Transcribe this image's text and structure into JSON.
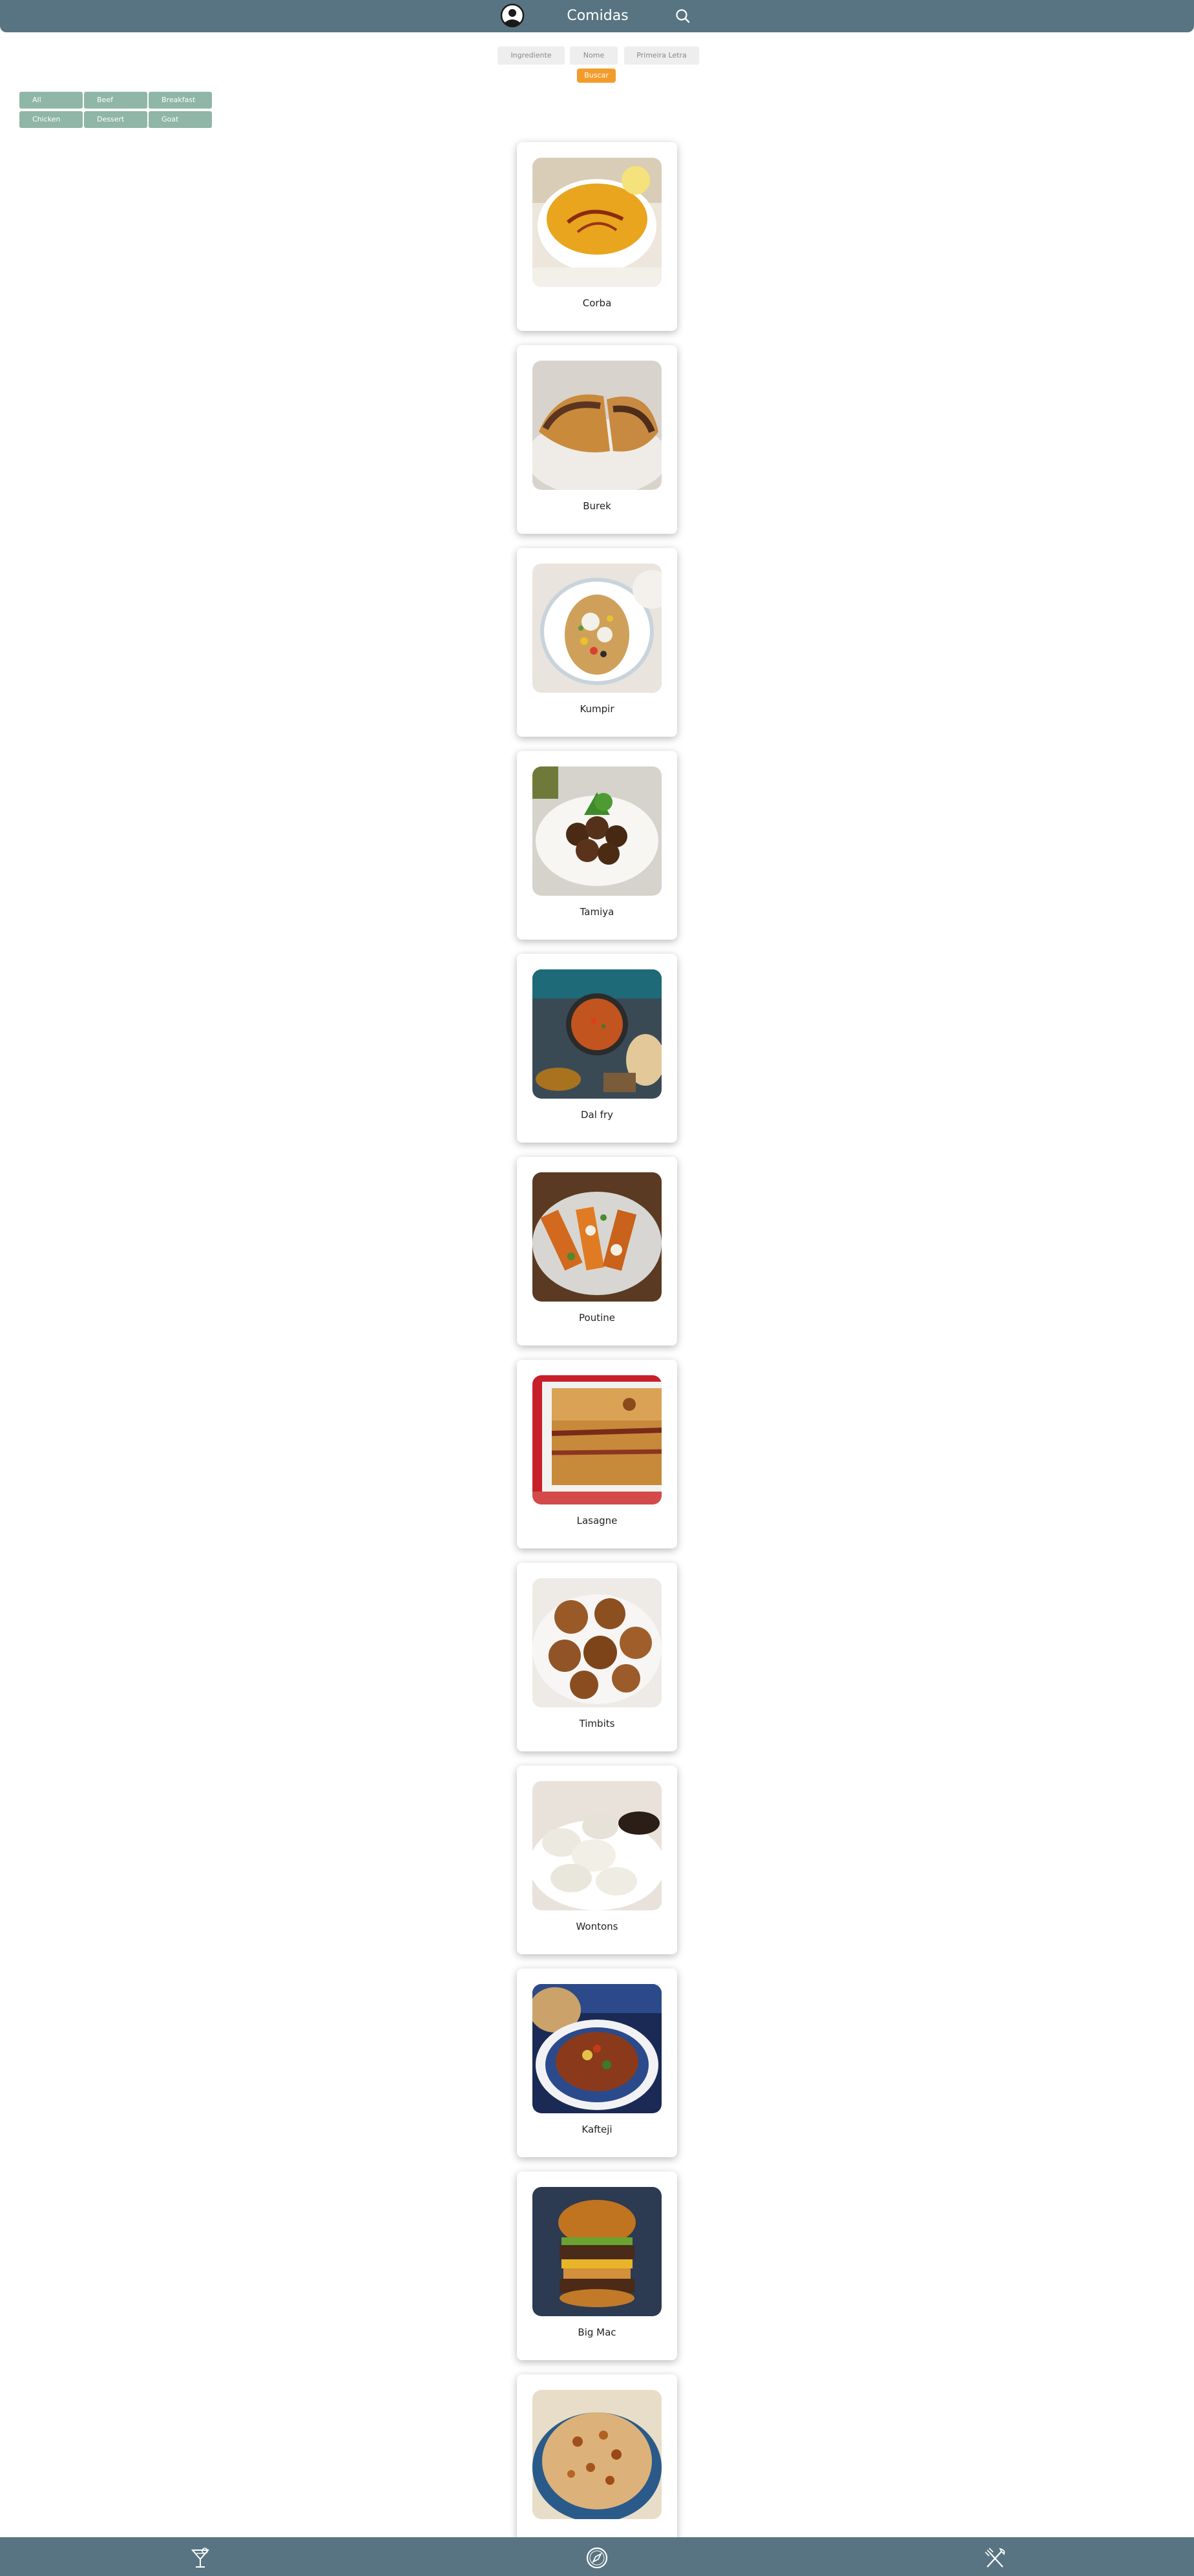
{
  "header": {
    "title": "Comidas",
    "profile_icon": "profile-icon",
    "search_icon": "search-icon",
    "color": "#587482"
  },
  "search_options": [
    {
      "label": "Ingrediente"
    },
    {
      "label": "Nome"
    },
    {
      "label": "Primeira Letra"
    }
  ],
  "search_button": {
    "label": "Buscar",
    "color": "#f39c2c"
  },
  "categories": [
    {
      "label": "All"
    },
    {
      "label": "Beef"
    },
    {
      "label": "Breakfast"
    },
    {
      "label": "Chicken"
    },
    {
      "label": "Dessert"
    },
    {
      "label": "Goat"
    }
  ],
  "recipes": [
    {
      "name": "Corba",
      "image": "lentil-soup"
    },
    {
      "name": "Burek",
      "image": "burek-pastry"
    },
    {
      "name": "Kumpir",
      "image": "baked-potato"
    },
    {
      "name": "Tamiya",
      "image": "falafel"
    },
    {
      "name": "Dal fry",
      "image": "dal-curry"
    },
    {
      "name": "Poutine",
      "image": "poutine"
    },
    {
      "name": "Lasagne",
      "image": "lasagne"
    },
    {
      "name": "Timbits",
      "image": "donut-holes"
    },
    {
      "name": "Wontons",
      "image": "dumplings"
    },
    {
      "name": "Kafteji",
      "image": "vegetable-stew"
    },
    {
      "name": "Big Mac",
      "image": "burger"
    },
    {
      "name": "",
      "image": "rice-dish"
    }
  ],
  "footer": {
    "icons": [
      "drinks-icon",
      "explore-icon",
      "food-icon"
    ],
    "color": "#587482"
  }
}
